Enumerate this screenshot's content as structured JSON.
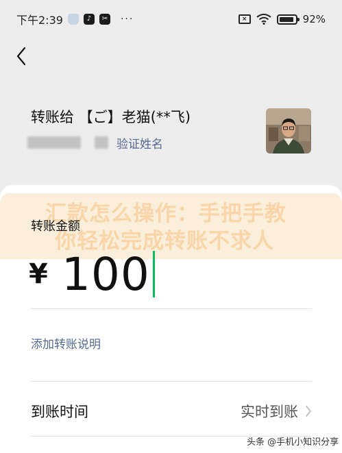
{
  "status_bar": {
    "time": "下午2:39",
    "battery": "92%",
    "more": "···"
  },
  "header": {
    "payee_name": "转账给 【ご】老猫(**飞)",
    "verify_link": "验证姓名"
  },
  "banner": {
    "line1": "汇款怎么操作：手把手教",
    "line2": "你轻松完成转账不求人"
  },
  "amount": {
    "label": "转账金额",
    "currency": "¥",
    "value": "100"
  },
  "note": {
    "add_label": "添加转账说明"
  },
  "arrival": {
    "label": "到账时间",
    "value": "实时到账"
  },
  "watermark": "头条 @手机小知识分享",
  "colors": {
    "accent_link": "#56698f",
    "cursor": "#07c160",
    "background": "#ededed"
  }
}
